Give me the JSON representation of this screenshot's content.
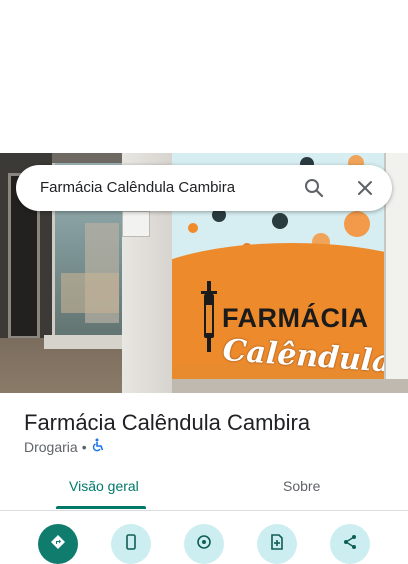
{
  "search": {
    "query": "Farmácia Calêndula Cambira",
    "search_icon": "search-icon",
    "close_icon": "close-icon"
  },
  "photo": {
    "sign_line1": "FARMÁCIA",
    "sign_line2": "Calêndula"
  },
  "place": {
    "name": "Farmácia Calêndula Cambira",
    "category": "Drogaria",
    "separator": "•",
    "accessibility_icon": "wheelchair-icon"
  },
  "tabs": [
    {
      "label": "Visão geral",
      "active": true
    },
    {
      "label": "Sobre",
      "active": false
    }
  ],
  "actions": [
    {
      "icon": "directions-icon",
      "primary": true
    },
    {
      "icon": "phone-icon",
      "primary": false
    },
    {
      "icon": "location-pin-icon",
      "primary": false
    },
    {
      "icon": "save-icon",
      "primary": false
    },
    {
      "icon": "share-icon",
      "primary": false
    }
  ],
  "colors": {
    "accent": "#00796b",
    "primary_button": "#0f7c6e",
    "secondary_button": "#cdeef0",
    "title_text": "#202124",
    "muted_text": "#5f6368",
    "accessibility_blue": "#1a73e8"
  }
}
